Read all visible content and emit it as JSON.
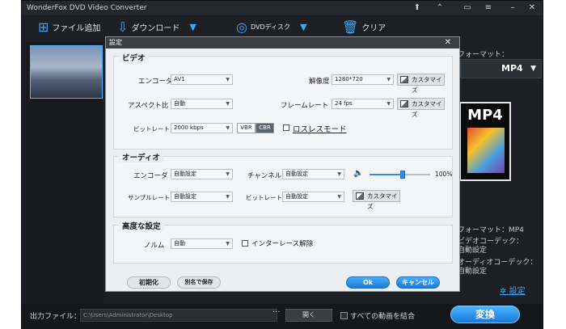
{
  "app": {
    "title": "WonderFox DVD Video Converter"
  },
  "window_controls": [
    "upload-icon",
    "skin-icon",
    "chat-icon",
    "menu-icon",
    "minimize-icon",
    "close-icon"
  ],
  "toolbar": {
    "add_file": "ファイル追加",
    "download": "ダウンロード",
    "dvd_disc": "DVDディスク",
    "clear": "クリア"
  },
  "right": {
    "format_label": "フォーマット：",
    "format_value": "MP4",
    "mp4_text": "MP4",
    "info_format": "フォーマット：MP4",
    "info_vcodec_label": "ビデオコーデック：",
    "info_vcodec_value": "自動設定",
    "info_acodec_label": "オーディオコーデック：",
    "info_acodec_value": "自動設定",
    "settings_link": "設定"
  },
  "bottom": {
    "output_label": "出力ファイル：",
    "output_path": "C:\\Users\\Administrator\\Desktop",
    "browse": "···",
    "open": "開く",
    "merge_label": "すべての動画を結合",
    "convert": "変換"
  },
  "dialog": {
    "title": "設定",
    "video": {
      "title": "ビデオ",
      "encoder_label": "エンコーダ",
      "encoder_value": "AV1",
      "resolution_label": "解像度",
      "resolution_value": "1280*720",
      "aspect_label": "アスペクト比",
      "aspect_value": "自動",
      "framerate_label": "フレームレート",
      "framerate_value": "24 fps",
      "bitrate_label": "ビットレート",
      "bitrate_value": "2000 kbps",
      "vbr": "VBR",
      "cbr": "CBR",
      "lossless": "ロスレスモード",
      "customize": "カスタマイズ"
    },
    "audio": {
      "title": "オーディオ",
      "encoder_label": "エンコーダ",
      "encoder_value": "自動設定",
      "channel_label": "チャンネル",
      "channel_value": "自動設定",
      "volume": "100%",
      "volume_level": 0.55,
      "samplerate_label": "サンプルレート",
      "samplerate_value": "自動設定",
      "bitrate_label": "ビットレート",
      "bitrate_value": "自動設定",
      "customize": "カスタマイズ"
    },
    "advanced": {
      "title": "高度な設定",
      "norm_label": "ノルム",
      "norm_value": "自動",
      "deinterlace": "インターレース解除"
    },
    "buttons": {
      "reset": "初期化",
      "save_as": "別名で保存",
      "ok": "Ok",
      "cancel": "キャンセル"
    }
  },
  "colors": {
    "accent": "#2d8ef0",
    "dark_bg": "#1d1f24"
  }
}
